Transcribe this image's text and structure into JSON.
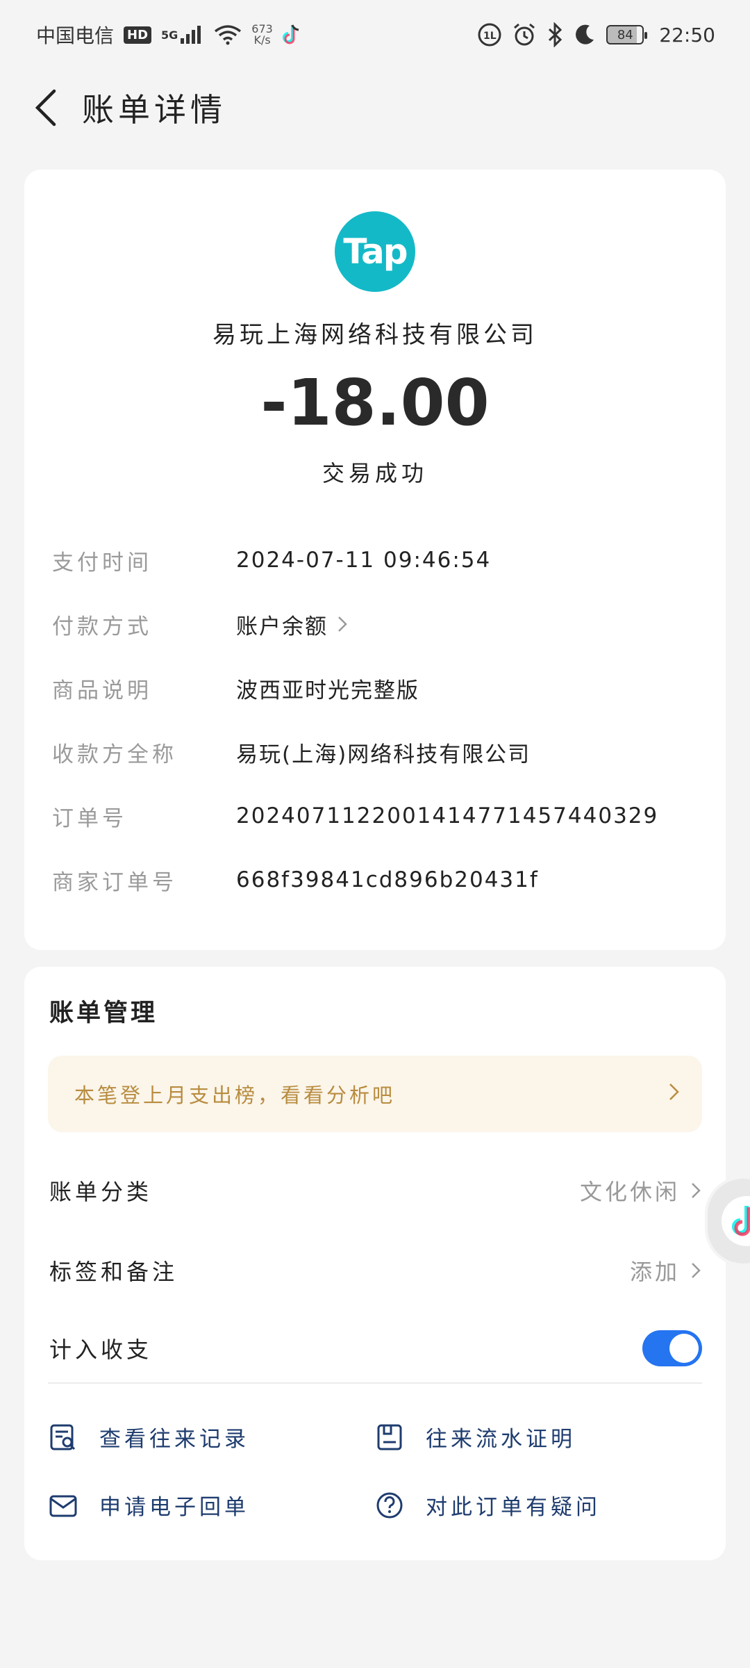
{
  "status_bar": {
    "carrier": "中国电信",
    "hd": "HD",
    "network": "5G",
    "speed_value": "673",
    "speed_unit": "K/s",
    "battery": "84",
    "time": "22:50"
  },
  "nav": {
    "title": "账单详情"
  },
  "transaction": {
    "logo_text": "Tap",
    "merchant": "易玩上海网络科技有限公司",
    "amount": "-18.00",
    "status": "交易成功"
  },
  "details": [
    {
      "label": "支付时间",
      "value": "2024-07-11 09:46:54"
    },
    {
      "label": "付款方式",
      "value": "账户余额"
    },
    {
      "label": "商品说明",
      "value": "波西亚时光完整版"
    },
    {
      "label": "收款方全称",
      "value": "易玩(上海)网络科技有限公司"
    },
    {
      "label": "订单号",
      "value": "2024071122001414771457440329"
    },
    {
      "label": "商家订单号",
      "value": "668f39841cd896b20431f"
    }
  ],
  "manage": {
    "title": "账单管理",
    "banner": "本笔登上月支出榜，看看分析吧",
    "category_label": "账单分类",
    "category_value": "文化休闲",
    "tags_label": "标签和备注",
    "tags_value": "添加",
    "include_label": "计入收支",
    "include_on": true,
    "actions": [
      {
        "label": "查看往来记录",
        "icon": "record-search-icon"
      },
      {
        "label": "往来流水证明",
        "icon": "document-icon"
      },
      {
        "label": "申请电子回单",
        "icon": "mail-icon"
      },
      {
        "label": "对此订单有疑问",
        "icon": "question-icon"
      }
    ]
  },
  "colors": {
    "logo": "#14b9c8",
    "toggle": "#2574f0",
    "banner_bg": "#fbf5ea",
    "banner_text": "#b88c3f",
    "action_text": "#1e3c6e"
  }
}
